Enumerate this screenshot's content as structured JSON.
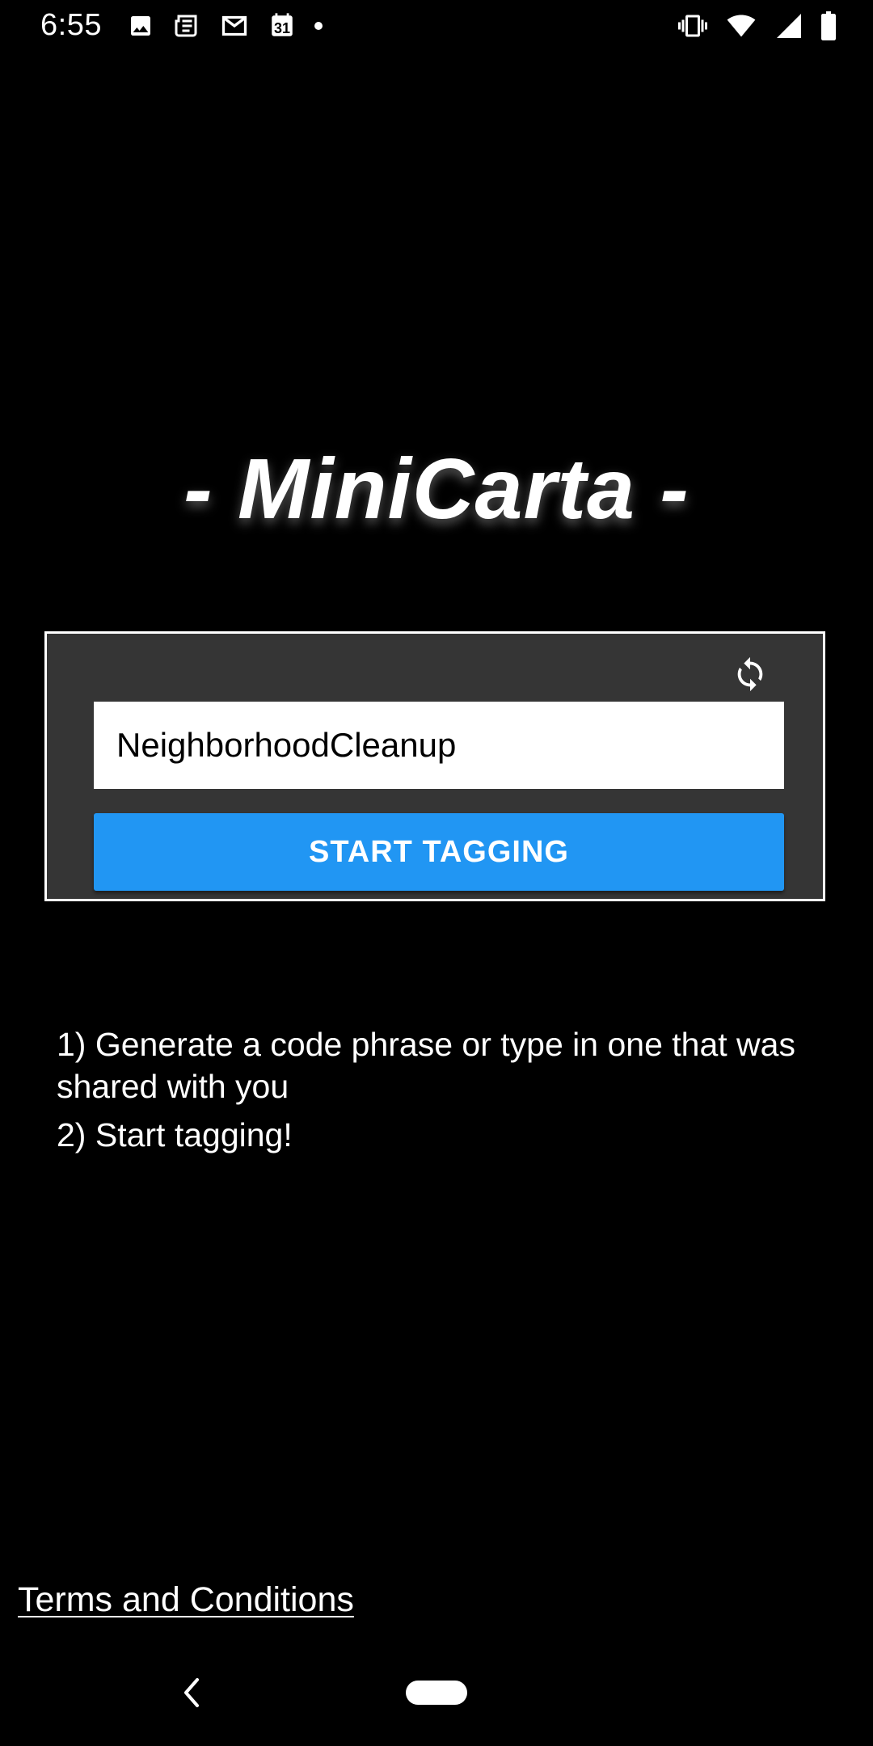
{
  "status_bar": {
    "time": "6:55",
    "left_icons": [
      "image-icon",
      "news-icon",
      "gmail-icon",
      "calendar-icon",
      "dot-icon"
    ],
    "calendar_day": "31",
    "right_icons": [
      "vibrate-icon",
      "wifi-icon",
      "signal-icon",
      "battery-icon"
    ]
  },
  "app": {
    "title": "- MiniCarta -"
  },
  "card": {
    "refresh_icon": "refresh-icon",
    "code_input_value": "NeighborhoodCleanup",
    "start_button_label": "START TAGGING"
  },
  "instructions": {
    "step1": "1) Generate a code phrase or type in one that was shared with you",
    "step2": "2) Start tagging!"
  },
  "footer": {
    "terms_link": "Terms and Conditions"
  },
  "colors": {
    "background": "#000000",
    "card_background": "#353535",
    "accent": "#2196f3",
    "text": "#ffffff"
  }
}
